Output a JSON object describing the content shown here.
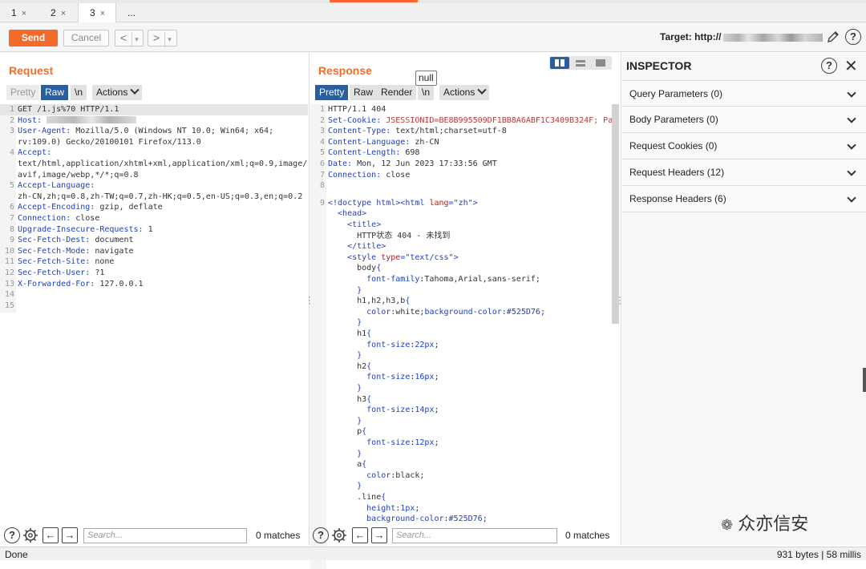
{
  "tabs": [
    {
      "label": "1",
      "active": false
    },
    {
      "label": "2",
      "active": false
    },
    {
      "label": "3",
      "active": true
    },
    {
      "label": "...",
      "active": false
    }
  ],
  "tab_close_glyph": "×",
  "toolbar": {
    "send_label": "Send",
    "cancel_label": "Cancel",
    "target_label": "Target: http://",
    "back_glyph": "<",
    "forward_glyph": ">",
    "dropdown_glyph": "▾"
  },
  "request": {
    "title": "Request",
    "tabs": {
      "pretty": "Pretty",
      "raw": "Raw",
      "newline": "\\n",
      "actions": "Actions"
    },
    "lines": [
      {
        "n": "1",
        "key": "GET /1.js%70 HTTP/1.1",
        "val": ""
      },
      {
        "n": "2",
        "key": "Host: ",
        "val": ""
      },
      {
        "n": "3",
        "key": "User-Agent: ",
        "val": "Mozilla/5.0 (Windows NT 10.0; Win64; x64;"
      },
      {
        "n": "",
        "key": "",
        "val": "rv:109.0) Gecko/20100101 Firefox/113.0"
      },
      {
        "n": "4",
        "key": "Accept: ",
        "val": ""
      },
      {
        "n": "",
        "key": "",
        "val": "text/html,application/xhtml+xml,application/xml;q=0.9,image/"
      },
      {
        "n": "",
        "key": "",
        "val": "avif,image/webp,*/*;q=0.8"
      },
      {
        "n": "5",
        "key": "Accept-Language: ",
        "val": ""
      },
      {
        "n": "",
        "key": "",
        "val": "zh-CN,zh;q=0.8,zh-TW;q=0.7,zh-HK;q=0.5,en-US;q=0.3,en;q=0.2"
      },
      {
        "n": "6",
        "key": "Accept-Encoding: ",
        "val": "gzip, deflate"
      },
      {
        "n": "7",
        "key": "Connection: ",
        "val": "close"
      },
      {
        "n": "8",
        "key": "Upgrade-Insecure-Requests: ",
        "val": "1"
      },
      {
        "n": "9",
        "key": "Sec-Fetch-Dest: ",
        "val": "document"
      },
      {
        "n": "10",
        "key": "Sec-Fetch-Mode: ",
        "val": "navigate"
      },
      {
        "n": "11",
        "key": "Sec-Fetch-Site: ",
        "val": "none"
      },
      {
        "n": "12",
        "key": "Sec-Fetch-User: ",
        "val": "?1"
      },
      {
        "n": "13",
        "key": "X-Forwarded-For: ",
        "val": "127.0.0.1"
      },
      {
        "n": "14",
        "key": "",
        "val": ""
      },
      {
        "n": "15",
        "key": "",
        "val": ""
      }
    ],
    "search_placeholder": "Search...",
    "matches": "0 matches"
  },
  "response": {
    "title": "Response",
    "tabs": {
      "pretty": "Pretty",
      "raw": "Raw",
      "render": "Render",
      "newline": "\\n",
      "actions": "Actions"
    },
    "tooltip": "null",
    "lines": [
      {
        "n": "1",
        "parts": [
          [
            "val",
            "HTTP/1.1 404"
          ]
        ]
      },
      {
        "n": "2",
        "parts": [
          [
            "hdr",
            "Set-Cookie: "
          ],
          [
            "cookieval",
            "JSESSIONID=BE8B995509DF1BB8A6ABF1C3409B324F; Pa"
          ]
        ]
      },
      {
        "n": "3",
        "parts": [
          [
            "hdr",
            "Content-Type: "
          ],
          [
            "val",
            "text/html;charset=utf-8"
          ]
        ]
      },
      {
        "n": "4",
        "parts": [
          [
            "hdr",
            "Content-Language: "
          ],
          [
            "val",
            "zh-CN"
          ]
        ]
      },
      {
        "n": "5",
        "parts": [
          [
            "hdr",
            "Content-Length: "
          ],
          [
            "val",
            "698"
          ]
        ]
      },
      {
        "n": "6",
        "parts": [
          [
            "hdr",
            "Date: "
          ],
          [
            "val",
            "Mon, 12 Jun 2023 17:33:56 GMT"
          ]
        ]
      },
      {
        "n": "7",
        "parts": [
          [
            "hdr",
            "Connection: "
          ],
          [
            "val",
            "close"
          ]
        ]
      },
      {
        "n": "8",
        "parts": []
      },
      {
        "n": "9",
        "parts": [
          [
            "tag",
            "<!doctype html><html "
          ],
          [
            "attr",
            "lang"
          ],
          [
            "tag",
            "="
          ],
          [
            "str",
            "\"zh\""
          ],
          [
            "tag",
            ">"
          ]
        ]
      },
      {
        "n": "",
        "parts": [
          [
            "tag",
            "  <head>"
          ]
        ]
      },
      {
        "n": "",
        "parts": [
          [
            "tag",
            "    <title>"
          ]
        ]
      },
      {
        "n": "",
        "parts": [
          [
            "val",
            "      HTTP状态 404 - 未找到"
          ]
        ]
      },
      {
        "n": "",
        "parts": [
          [
            "tag",
            "    </title>"
          ]
        ]
      },
      {
        "n": "",
        "parts": [
          [
            "tag",
            "    <style "
          ],
          [
            "attr",
            "type"
          ],
          [
            "tag",
            "="
          ],
          [
            "str",
            "\"text/css\""
          ],
          [
            "tag",
            ">"
          ]
        ]
      },
      {
        "n": "",
        "parts": [
          [
            "val",
            "      body"
          ],
          [
            "tag",
            "{"
          ]
        ]
      },
      {
        "n": "",
        "parts": [
          [
            "str",
            "        font-family"
          ],
          [
            "val",
            ":Tahoma,Arial,sans-serif;"
          ]
        ]
      },
      {
        "n": "",
        "parts": [
          [
            "tag",
            "      }"
          ]
        ]
      },
      {
        "n": "",
        "parts": [
          [
            "val",
            "      h1,h2,h3,b"
          ],
          [
            "tag",
            "{"
          ]
        ]
      },
      {
        "n": "",
        "parts": [
          [
            "str",
            "        color"
          ],
          [
            "val",
            ":white;"
          ],
          [
            "str",
            "background-color"
          ],
          [
            "val",
            ":"
          ],
          [
            "str",
            "#525D76"
          ],
          [
            "val",
            ";"
          ]
        ]
      },
      {
        "n": "",
        "parts": [
          [
            "tag",
            "      }"
          ]
        ]
      },
      {
        "n": "",
        "parts": [
          [
            "val",
            "      h1"
          ],
          [
            "tag",
            "{"
          ]
        ]
      },
      {
        "n": "",
        "parts": [
          [
            "str",
            "        font-size"
          ],
          [
            "val",
            ":"
          ],
          [
            "str",
            "22px"
          ],
          [
            "val",
            ";"
          ]
        ]
      },
      {
        "n": "",
        "parts": [
          [
            "tag",
            "      }"
          ]
        ]
      },
      {
        "n": "",
        "parts": [
          [
            "val",
            "      h2"
          ],
          [
            "tag",
            "{"
          ]
        ]
      },
      {
        "n": "",
        "parts": [
          [
            "str",
            "        font-size"
          ],
          [
            "val",
            ":"
          ],
          [
            "str",
            "16px"
          ],
          [
            "val",
            ";"
          ]
        ]
      },
      {
        "n": "",
        "parts": [
          [
            "tag",
            "      }"
          ]
        ]
      },
      {
        "n": "",
        "parts": [
          [
            "val",
            "      h3"
          ],
          [
            "tag",
            "{"
          ]
        ]
      },
      {
        "n": "",
        "parts": [
          [
            "str",
            "        font-size"
          ],
          [
            "val",
            ":"
          ],
          [
            "str",
            "14px"
          ],
          [
            "val",
            ";"
          ]
        ]
      },
      {
        "n": "",
        "parts": [
          [
            "tag",
            "      }"
          ]
        ]
      },
      {
        "n": "",
        "parts": [
          [
            "val",
            "      p"
          ],
          [
            "tag",
            "{"
          ]
        ]
      },
      {
        "n": "",
        "parts": [
          [
            "str",
            "        font-size"
          ],
          [
            "val",
            ":"
          ],
          [
            "str",
            "12px"
          ],
          [
            "val",
            ";"
          ]
        ]
      },
      {
        "n": "",
        "parts": [
          [
            "tag",
            "      }"
          ]
        ]
      },
      {
        "n": "",
        "parts": [
          [
            "val",
            "      a"
          ],
          [
            "tag",
            "{"
          ]
        ]
      },
      {
        "n": "",
        "parts": [
          [
            "str",
            "        color"
          ],
          [
            "val",
            ":black;"
          ]
        ]
      },
      {
        "n": "",
        "parts": [
          [
            "tag",
            "      }"
          ]
        ]
      },
      {
        "n": "",
        "parts": [
          [
            "val",
            "      .line"
          ],
          [
            "tag",
            "{"
          ]
        ]
      },
      {
        "n": "",
        "parts": [
          [
            "str",
            "        height"
          ],
          [
            "val",
            ":"
          ],
          [
            "str",
            "1px"
          ],
          [
            "val",
            ";"
          ]
        ]
      },
      {
        "n": "",
        "parts": [
          [
            "str",
            "        background-color"
          ],
          [
            "val",
            ":"
          ],
          [
            "str",
            "#525D76"
          ],
          [
            "val",
            ";"
          ]
        ]
      }
    ],
    "search_placeholder": "Search...",
    "matches": "0 matches"
  },
  "inspector": {
    "title": "INSPECTOR",
    "sections": [
      "Query Parameters (0)",
      "Body Parameters (0)",
      "Request Cookies (0)",
      "Request Headers (12)",
      "Response Headers (6)"
    ]
  },
  "status": {
    "left": "Done",
    "right": "931 bytes | 58 millis"
  },
  "watermark": "众亦信安",
  "colors": {
    "accent_orange": "#f26b2a",
    "title_orange": "#f06f2c",
    "active_blue": "#2a5e9e",
    "header_blue": "#1e40c8",
    "attr_red": "#b21e1e"
  },
  "icons": [
    "help-icon",
    "close-icon",
    "pencil-icon",
    "gear-icon",
    "arrow-left-icon",
    "arrow-right-icon",
    "chevron-down-icon"
  ]
}
